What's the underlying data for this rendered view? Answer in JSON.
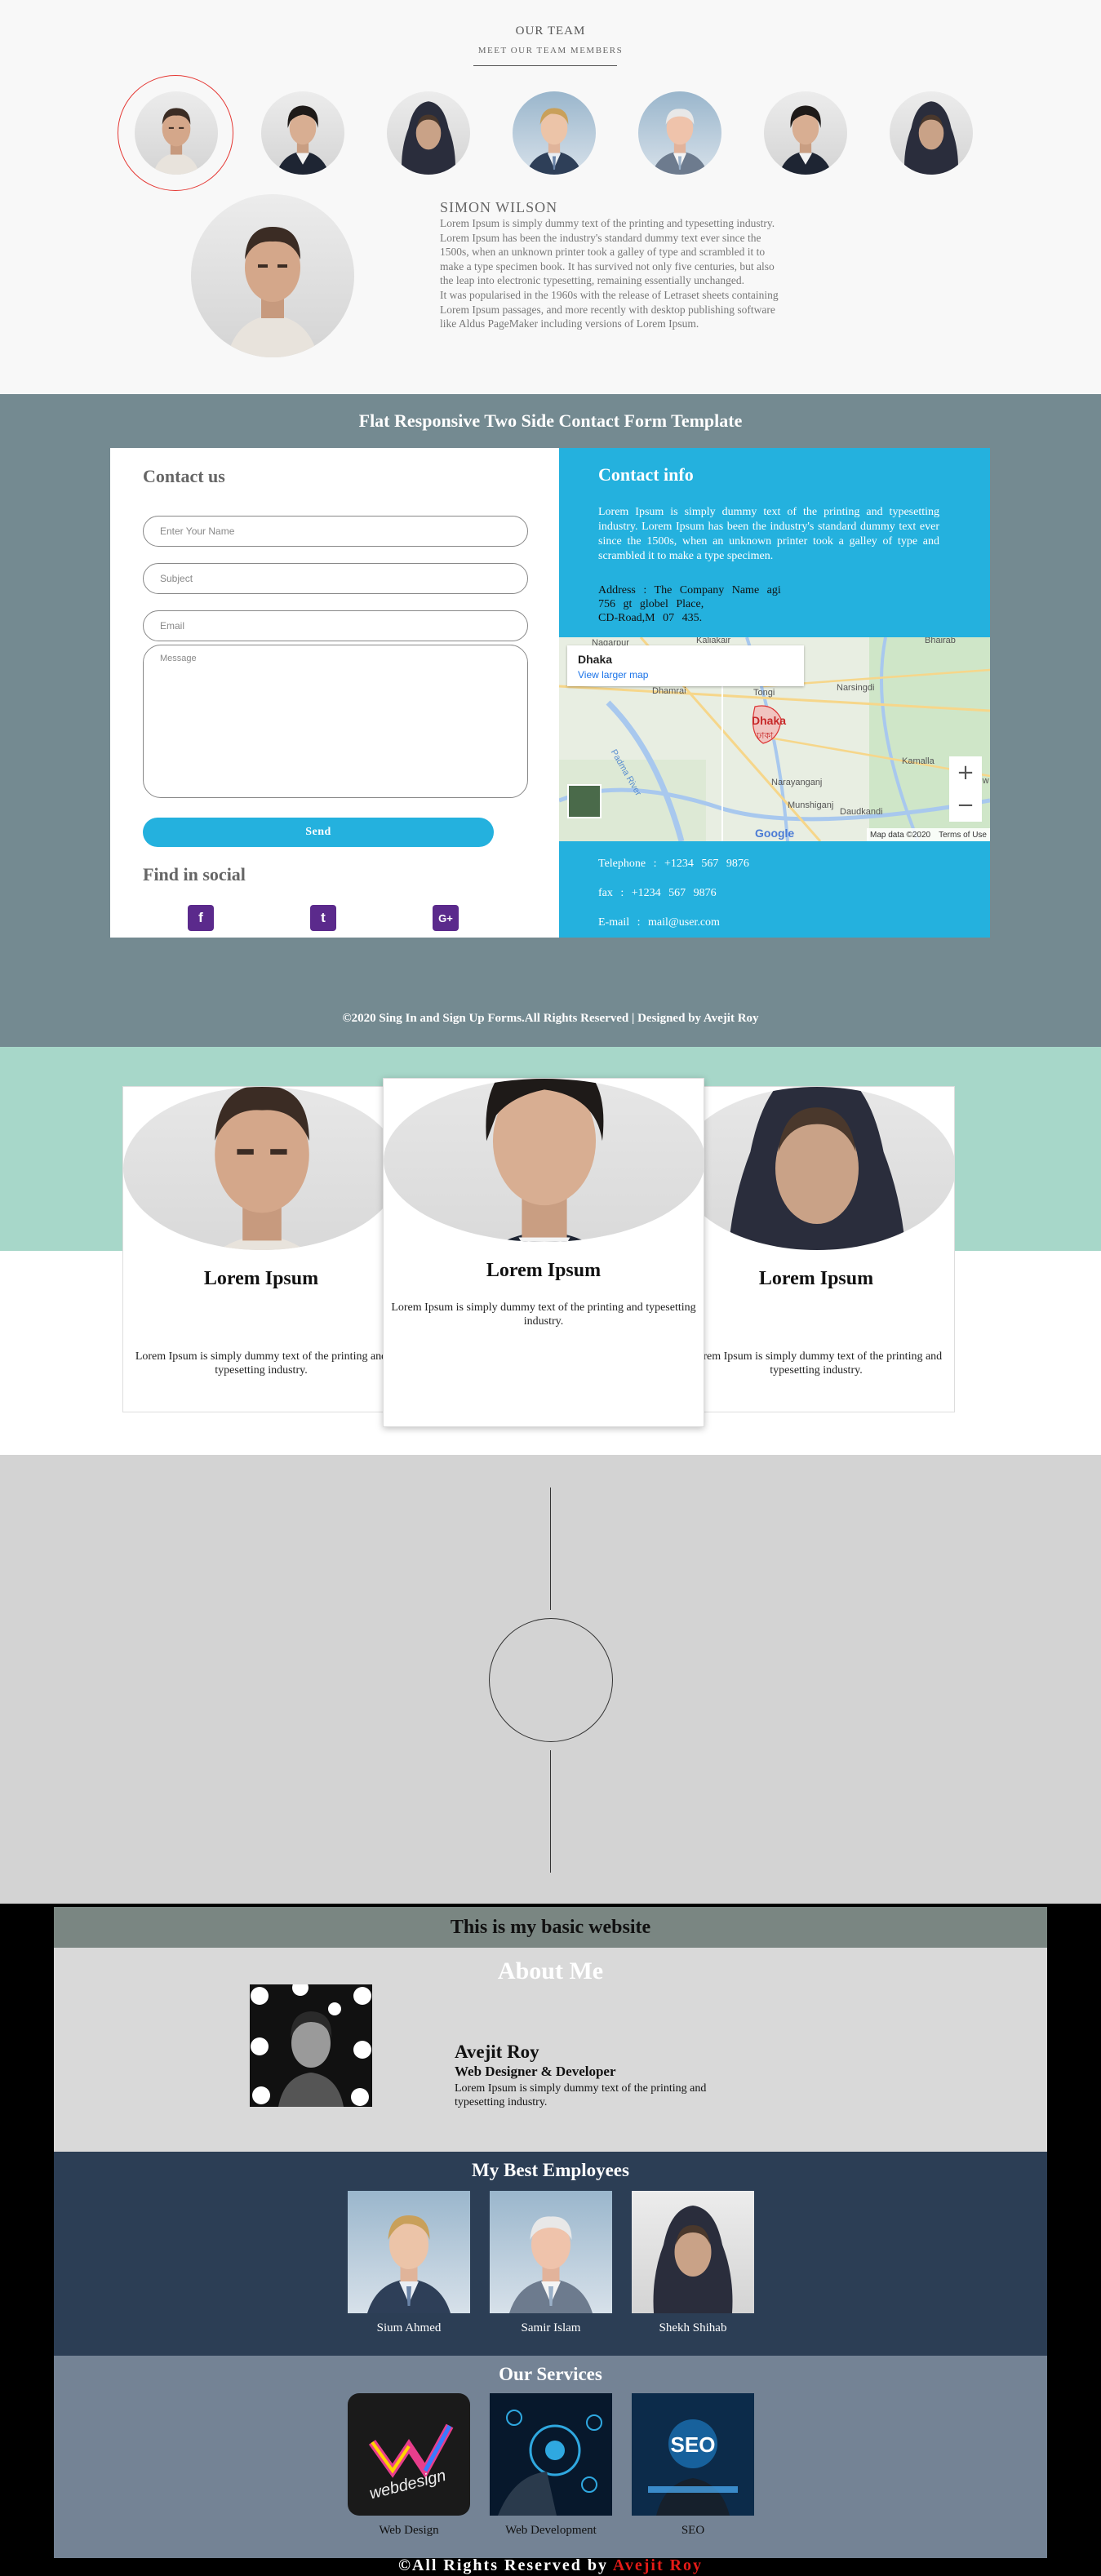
{
  "team": {
    "title": "OUR TEAM",
    "subtitle": "MEET OUR TEAM MEMBERS",
    "selected_name": "SIMON WILSON",
    "bio_paragraph_1": "Lorem Ipsum is simply dummy text of the printing and typesetting industry. Lorem Ipsum has been the industry's standard dummy text ever since the 1500s, when an unknown printer took a galley of type and scrambled it to make a type specimen book. It has survived not only five centuries, but also the leap into electronic typesetting, remaining essentially unchanged.",
    "bio_paragraph_2": "It was popularised in the 1960s with the release of Letraset sheets containing Lorem Ipsum passages, and more recently with desktop publishing software like Aldus PageMaker including versions of Lorem Ipsum."
  },
  "contact": {
    "heading": "Flat Responsive Two Side Contact Form Template",
    "form_title": "Contact us",
    "name_placeholder": "Enter Your Name",
    "subject_placeholder": "Subject",
    "email_placeholder": "Email",
    "message_placeholder": "Message",
    "send_label": "Send",
    "social_title": "Find in social",
    "social_icons": [
      "facebook-icon",
      "twitter-icon",
      "google-plus-icon"
    ],
    "social_glyphs": [
      "f",
      "t",
      "G+"
    ],
    "info_title": "Contact info",
    "info_text": "Lorem Ipsum is simply dummy text of the printing and typesetting industry. Lorem Ipsum has been the industry's standard dummy text ever since the 1500s, when an unknown printer took a galley of type and scrambled it to make a type specimen.",
    "address_line_1": "Address : The Company Name agi",
    "address_line_2": "756 gt globel Place,",
    "address_line_3": "CD-Road,M 07 435.",
    "map": {
      "place": "Dhaka",
      "link": "View larger map",
      "zoom_in": "+",
      "zoom_out": "−",
      "attribution": "Map data ©2020",
      "terms": "Terms of Use",
      "brand": "Google",
      "labels": [
        "Nagarpur",
        "Kaliakair",
        "Bhairab",
        "Tongi",
        "Narsingdi",
        "Dhamrai",
        "Dhaka",
        "ঢাকা",
        "Kamalla",
        "Narayanganj",
        "Debidw",
        "Padma River",
        "Munshiganj",
        "Daudkandi"
      ]
    },
    "telephone": "Telephone : +1234 567 9876",
    "fax": "fax : +1234 567 9876",
    "email": "E-mail : mail@user.com",
    "copyright": "©2020 Sing In and Sign Up Forms.All Rights Reserved | Designed by Avejit Roy",
    "brand_color": "#24b1de"
  },
  "cards": [
    {
      "title": "Lorem Ipsum",
      "text": "Lorem Ipsum is simply dummy text of the printing and typesetting industry."
    },
    {
      "title": "Lorem Ipsum",
      "text": "Lorem Ipsum is simply dummy text of the printing and typesetting industry."
    },
    {
      "title": "Lorem Ipsum",
      "text": "Lorem Ipsum is simply dummy text of the printing and typesetting industry."
    }
  ],
  "basic": {
    "header": "This is my basic website",
    "about_heading": "About Me",
    "about_name": "Avejit Roy",
    "about_role": "Web Designer & Developer",
    "about_text": "Lorem Ipsum is simply dummy text of the printing and typesetting industry.",
    "employees_heading": "My Best Employees",
    "employees": [
      "Sium Ahmed",
      "Samir Islam",
      "Shekh Shihab"
    ],
    "services_heading": "Our Services",
    "services": [
      "Web Design",
      "Web Development",
      "SEO"
    ],
    "service_art_text": [
      "webdesign",
      "SEO"
    ],
    "footer_prefix": "©All Rights Reserved by ",
    "footer_name": "Avejit Roy",
    "footer_name_color": "#e41b17"
  }
}
